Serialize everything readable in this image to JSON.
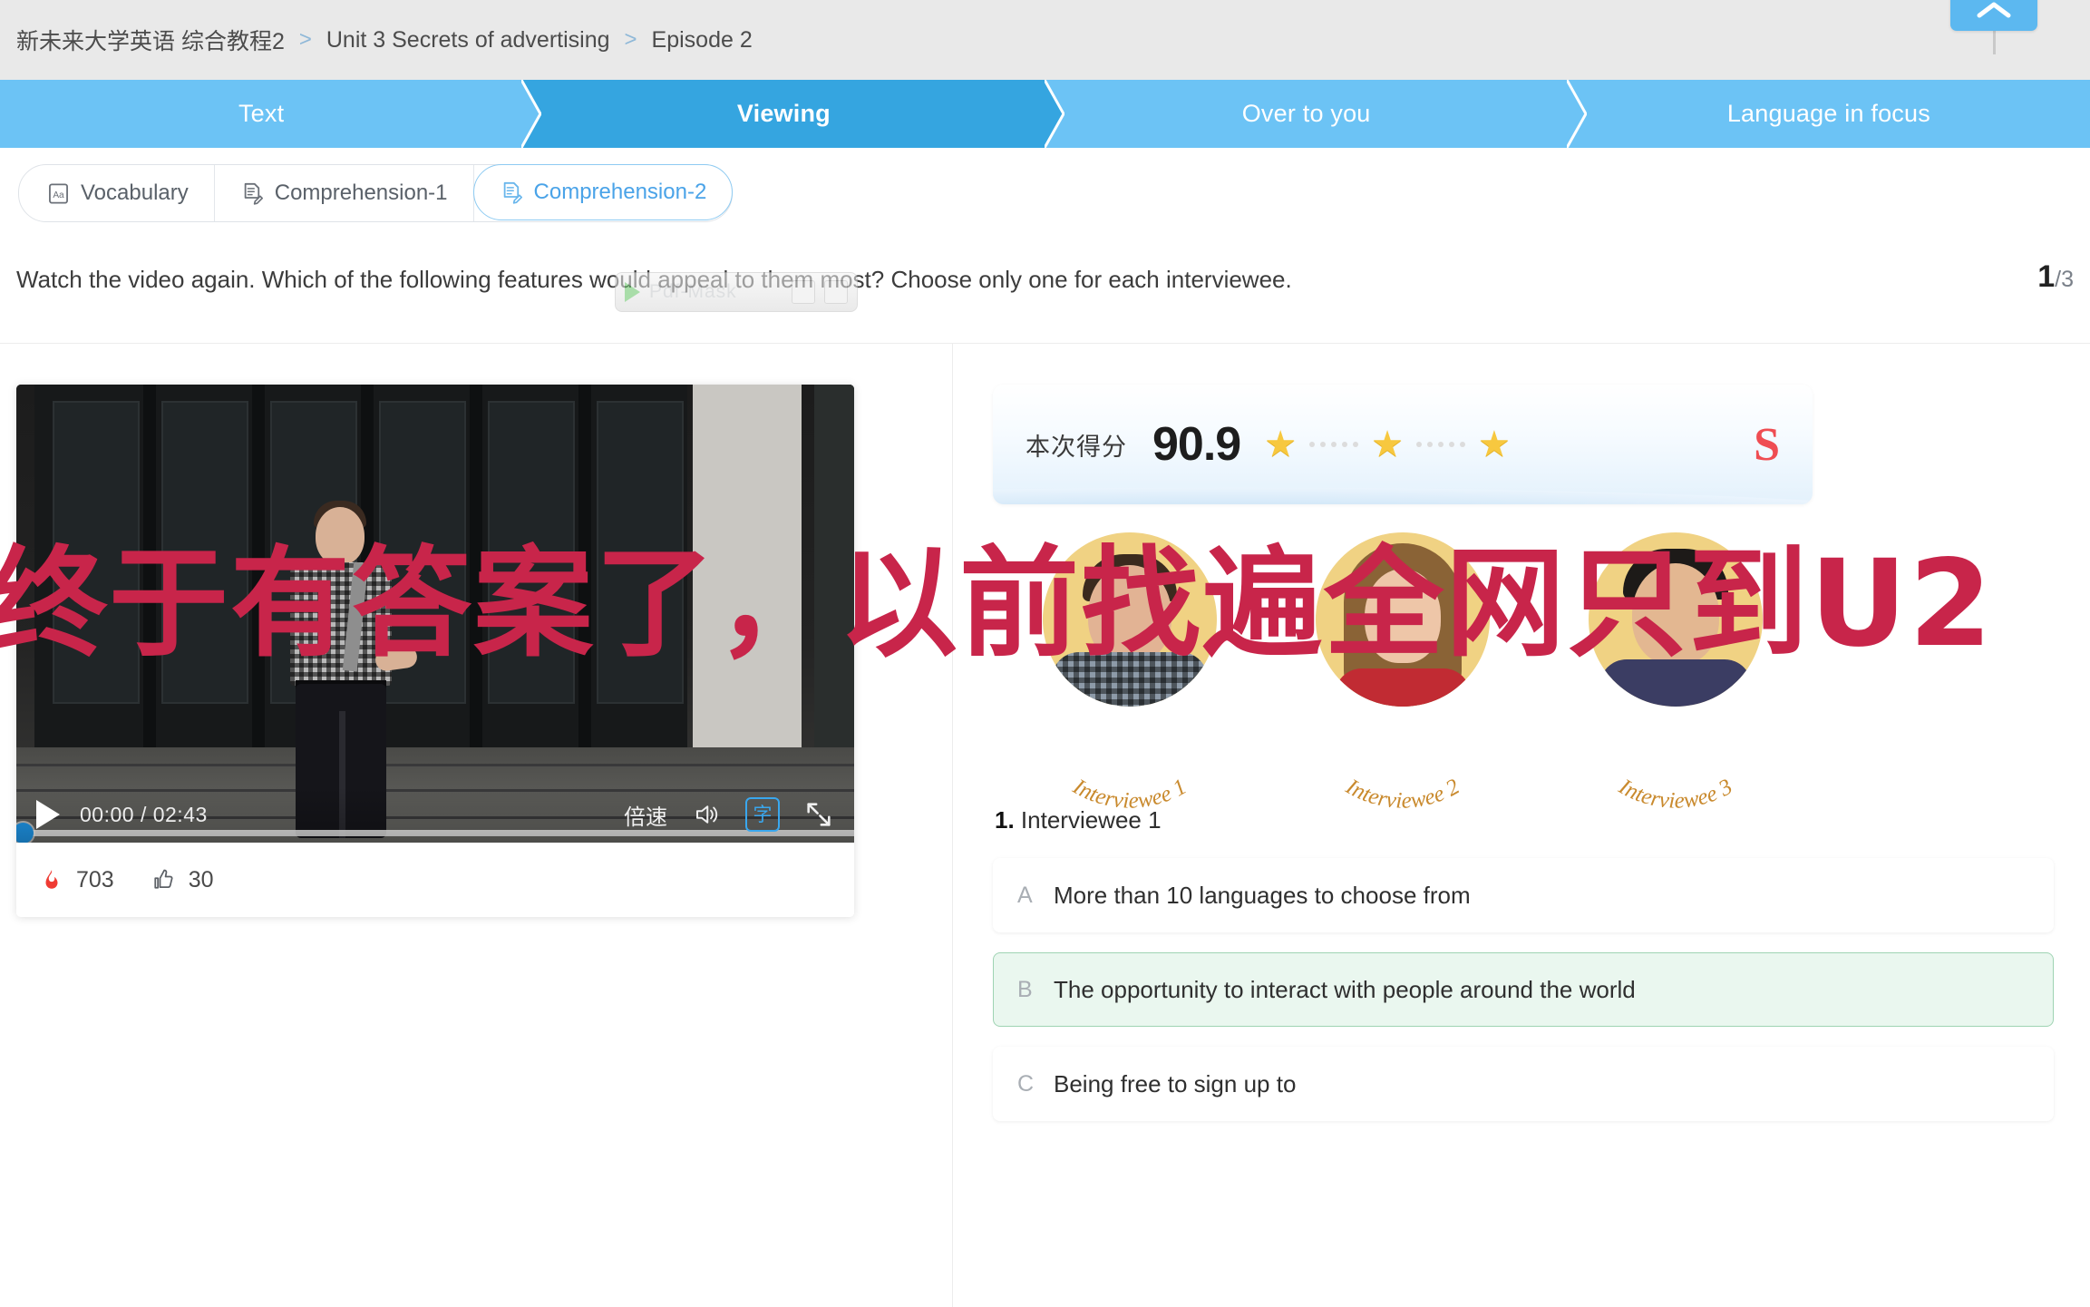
{
  "breadcrumb": {
    "items": [
      "新未来大学英语 综合教程2",
      "Unit 3 Secrets of advertising",
      "Episode 2"
    ],
    "separator": ">"
  },
  "header": {
    "collapse_icon": "chevron-up-icon"
  },
  "tabs": [
    {
      "label": "Text",
      "active": false
    },
    {
      "label": "Viewing",
      "active": true
    },
    {
      "label": "Over to you",
      "active": false
    },
    {
      "label": "Language in focus",
      "active": false
    }
  ],
  "subtabs": [
    {
      "label": "Vocabulary",
      "icon": "aa-card-icon",
      "active": false
    },
    {
      "label": "Comprehension-1",
      "icon": "note-edit-icon",
      "active": false
    },
    {
      "label": "Comprehension-2",
      "icon": "note-edit-icon",
      "active": true
    }
  ],
  "instruction": "Watch the video again. Which of the following features would appeal to them most? Choose only one for each interviewee.",
  "pager": {
    "current": "1",
    "separator": "/",
    "total": "3"
  },
  "ghost_widget": {
    "label": "Pdf-Mask"
  },
  "video": {
    "current_time": "00:00",
    "duration": "02:43",
    "timecode": "00:00 / 02:43",
    "speed_label": "倍速",
    "subtitle_label": "字",
    "progress_percent": 0,
    "play_icon": "play-icon",
    "volume_icon": "volume-icon",
    "fullscreen_icon": "fullscreen-icon"
  },
  "video_stats": [
    {
      "icon": "flame-icon",
      "value": "703"
    },
    {
      "icon": "thumbs-up-icon",
      "value": "30"
    }
  ],
  "score_card": {
    "label": "本次得分",
    "value": "90.9",
    "stars_filled": 3,
    "rank": "S",
    "rank_color": "#ef4d52",
    "star_color": "#f7c83f"
  },
  "interviewees": [
    {
      "caption": "Interviewee 1"
    },
    {
      "caption": "Interviewee 2"
    },
    {
      "caption": "Interviewee 3"
    }
  ],
  "question": {
    "number": "1.",
    "title": "Interviewee 1",
    "options": [
      {
        "letter": "A",
        "text": "More than 10 languages to choose from",
        "selected": false
      },
      {
        "letter": "B",
        "text": "The opportunity to interact with people around the world",
        "selected": true
      },
      {
        "letter": "C",
        "text": "Being free to sign up to",
        "selected": false
      }
    ],
    "correct_color": "#9fd3b3"
  },
  "overlay_text": "终于有答案了，以前找遍全网只到U2",
  "colors": {
    "tab_inactive": "#6cc3f5",
    "tab_active": "#35a5e0",
    "accent": "#4aa3e8",
    "overlay_red": "#c8254a"
  }
}
